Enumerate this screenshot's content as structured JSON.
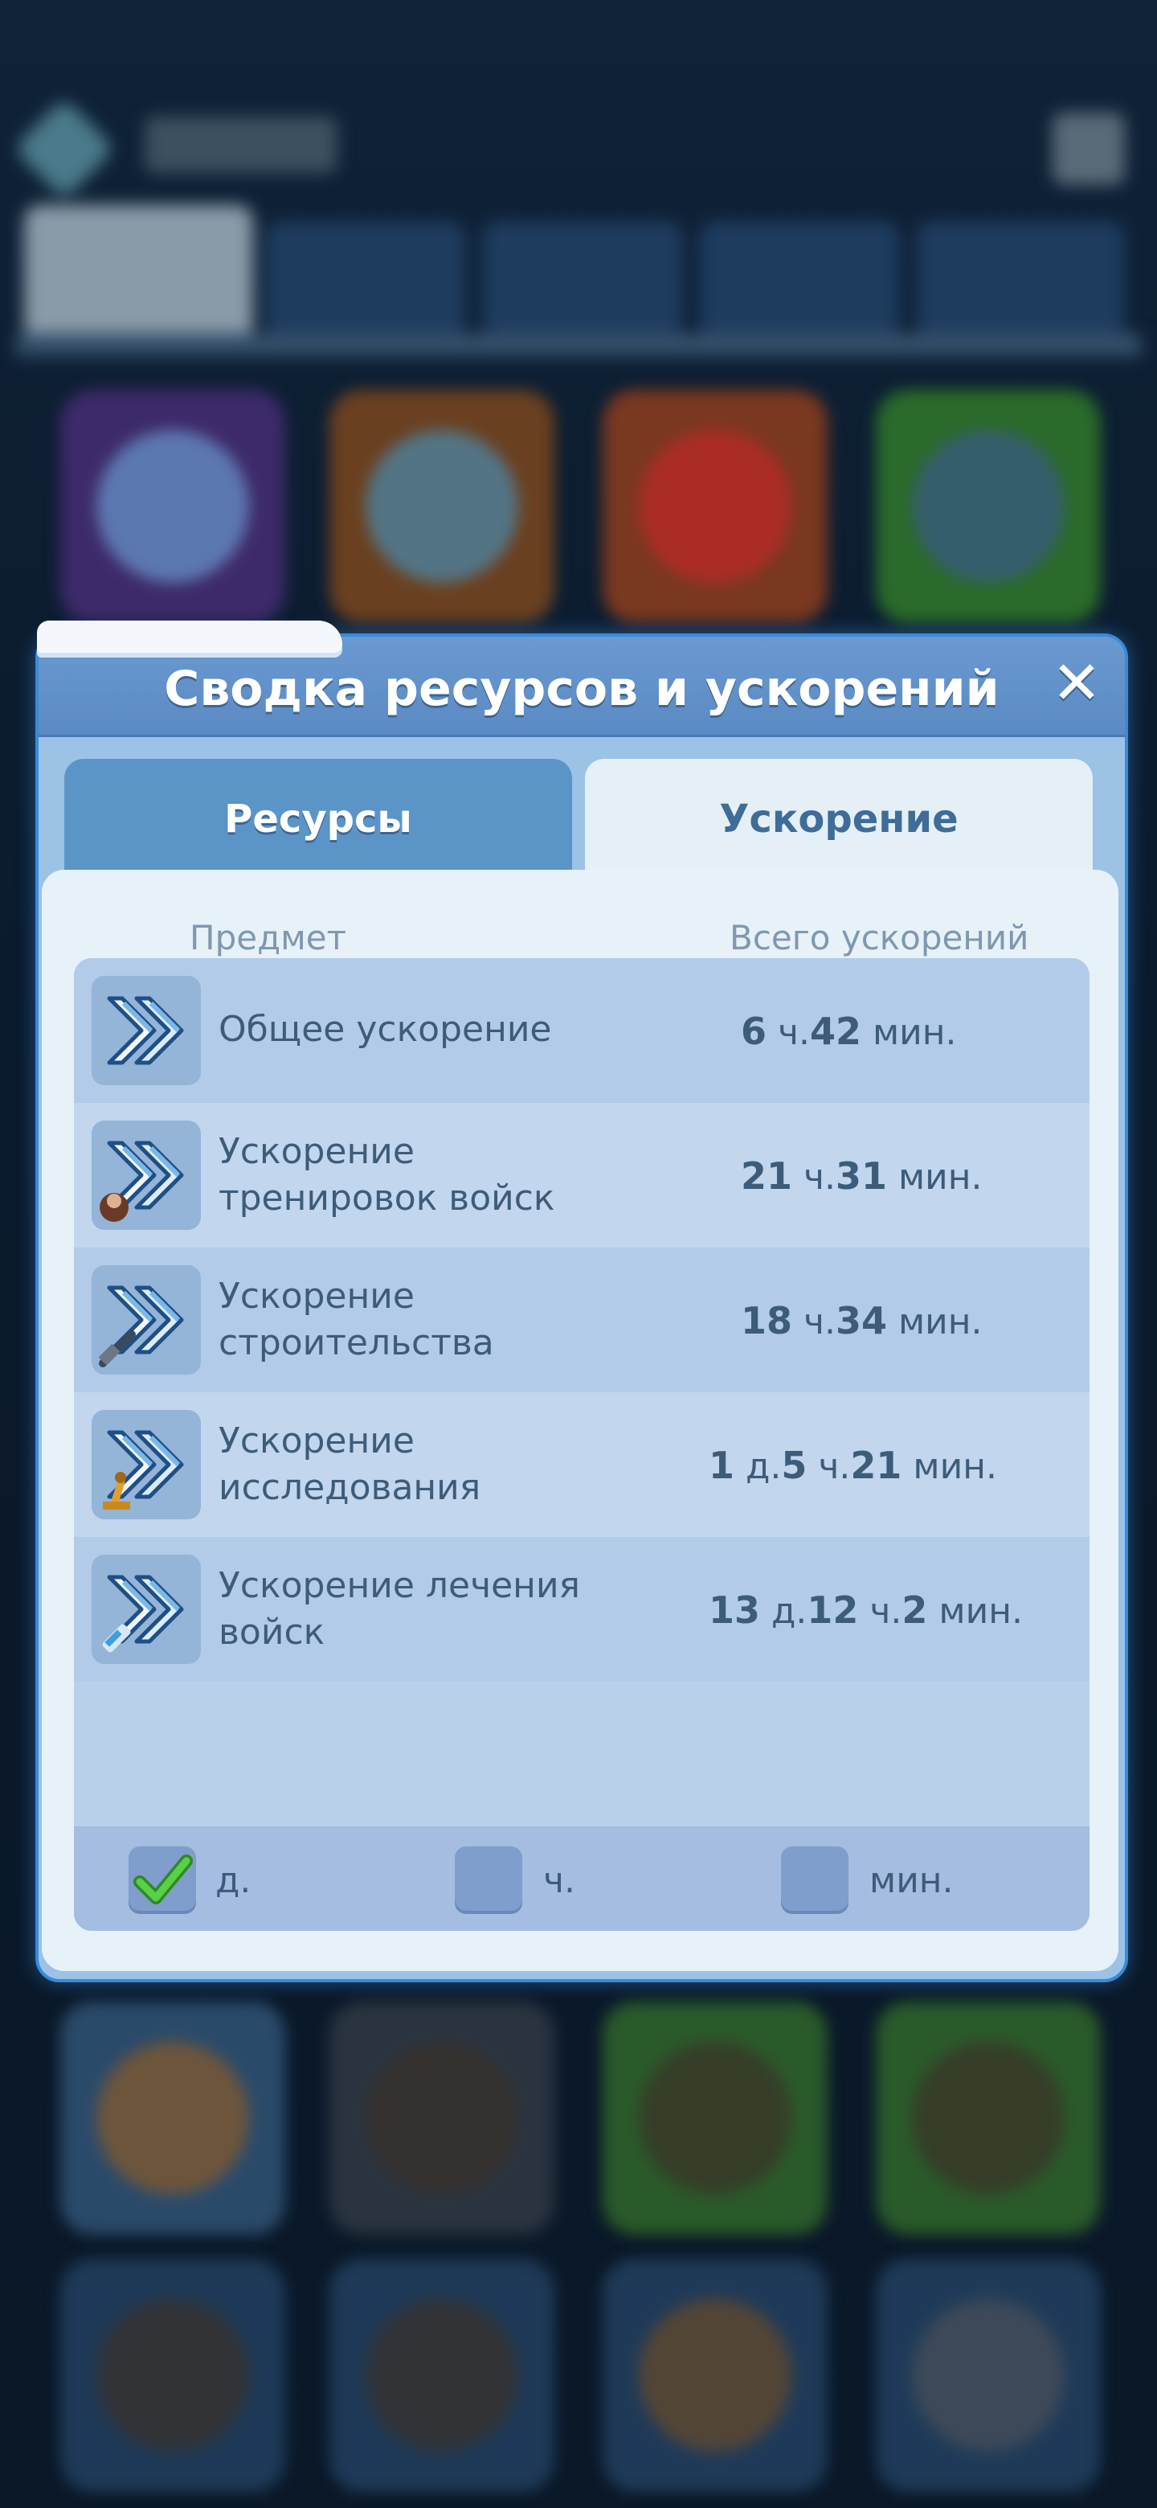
{
  "dialog": {
    "title": "Сводка ресурсов и ускорений",
    "close_glyph": "✕",
    "tabs": [
      {
        "label": "Ресурсы",
        "active": false
      },
      {
        "label": "Ускорение",
        "active": true
      }
    ],
    "columns": {
      "item": "Предмет",
      "total": "Всего ускорений"
    },
    "rows": [
      {
        "label_lines": [
          "Общее ускорение"
        ],
        "icon": "speedup-general-icon",
        "value": [
          {
            "n": "6",
            "u": " ч."
          },
          {
            "n": "42",
            "u": " мин."
          }
        ]
      },
      {
        "label_lines": [
          "Ускорение",
          "тренировок войск"
        ],
        "icon": "speedup-training-icon",
        "value": [
          {
            "n": "21",
            "u": " ч."
          },
          {
            "n": "31",
            "u": " мин."
          }
        ]
      },
      {
        "label_lines": [
          "Ускорение",
          "строительства"
        ],
        "icon": "speedup-building-icon",
        "value": [
          {
            "n": "18",
            "u": " ч."
          },
          {
            "n": "34",
            "u": " мин."
          }
        ]
      },
      {
        "label_lines": [
          "Ускорение",
          "исследования"
        ],
        "icon": "speedup-research-icon",
        "value": [
          {
            "n": "1",
            "u": " д."
          },
          {
            "n": "5",
            "u": " ч."
          },
          {
            "n": "21",
            "u": " мин."
          }
        ]
      },
      {
        "label_lines": [
          "Ускорение лечения",
          "войск"
        ],
        "icon": "speedup-healing-icon",
        "value": [
          {
            "n": "13",
            "u": " д."
          },
          {
            "n": "12",
            "u": " ч."
          },
          {
            "n": "2",
            "u": " мин."
          }
        ]
      }
    ],
    "units": [
      {
        "label": "д.",
        "checked": true
      },
      {
        "label": "ч.",
        "checked": false
      },
      {
        "label": "мин.",
        "checked": false
      }
    ]
  },
  "colors": {
    "accent": "#3a8ad8",
    "header": "#5b8ac4",
    "check_green": "#45c23a"
  }
}
